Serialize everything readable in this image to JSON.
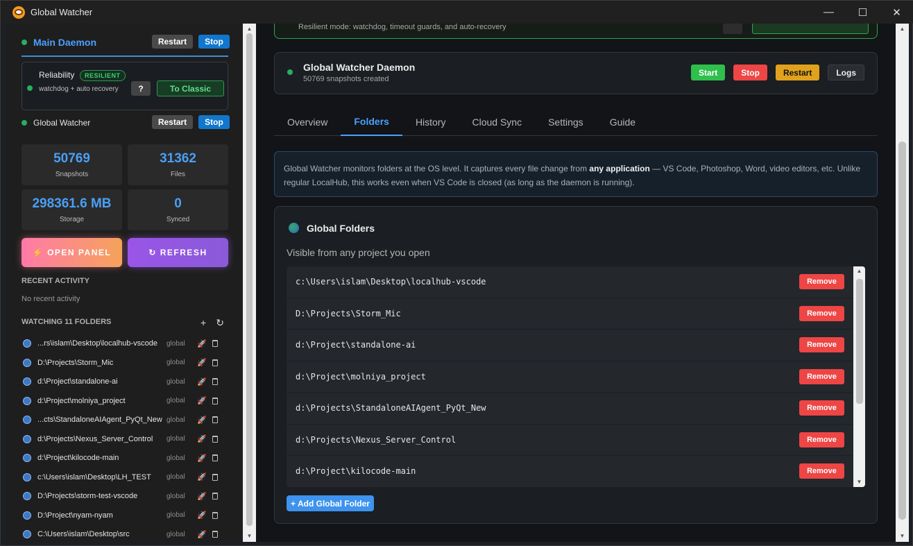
{
  "window": {
    "title": "Global Watcher"
  },
  "sidebar": {
    "main_daemon": {
      "name": "Main Daemon",
      "restart_label": "Restart",
      "stop_label": "Stop"
    },
    "reliability": {
      "title": "Reliability",
      "badge": "RESILIENT",
      "description": "watchdog + auto recovery",
      "help_label": "?",
      "classic_label": "To Classic"
    },
    "global_watcher": {
      "name": "Global Watcher",
      "restart_label": "Restart",
      "stop_label": "Stop"
    },
    "stats": [
      {
        "value": "50769",
        "label": "Snapshots"
      },
      {
        "value": "31362",
        "label": "Files"
      },
      {
        "value": "298361.6 MB",
        "label": "Storage"
      },
      {
        "value": "0",
        "label": "Synced"
      }
    ],
    "open_panel_label": "⚡ OPEN PANEL",
    "refresh_label": "↻ REFRESH",
    "recent_activity_label": "RECENT ACTIVITY",
    "no_activity": "No recent activity",
    "watching_label": "WATCHING 11 FOLDERS",
    "add_icon_glyph": "+",
    "refresh_icon_glyph": "↻",
    "folders": [
      {
        "path": "...rs\\islam\\Desktop\\localhub-vscode",
        "tag": "global"
      },
      {
        "path": "D:\\Projects\\Storm_Mic",
        "tag": "global"
      },
      {
        "path": "d:\\Project\\standalone-ai",
        "tag": "global"
      },
      {
        "path": "d:\\Project\\molniya_project",
        "tag": "global"
      },
      {
        "path": "...cts\\StandaloneAIAgent_PyQt_New",
        "tag": "global"
      },
      {
        "path": "d:\\Projects\\Nexus_Server_Control",
        "tag": "global"
      },
      {
        "path": "d:\\Project\\kilocode-main",
        "tag": "global"
      },
      {
        "path": "c:\\Users\\islam\\Desktop\\LH_TEST",
        "tag": "global"
      },
      {
        "path": "D:\\Projects\\storm-test-vscode",
        "tag": "global"
      },
      {
        "path": "D:\\Project\\nyam-nyam",
        "tag": "global"
      },
      {
        "path": "C:\\Users\\islam\\Desktop\\src",
        "tag": "global"
      }
    ]
  },
  "main": {
    "resilient_text": "Resilient mode: watchdog, timeout guards, and auto-recovery",
    "daemon": {
      "title": "Global Watcher Daemon",
      "subtitle": "50769 snapshots created",
      "start_label": "Start",
      "stop_label": "Stop",
      "restart_label": "Restart",
      "logs_label": "Logs"
    },
    "tabs": [
      "Overview",
      "Folders",
      "History",
      "Cloud Sync",
      "Settings",
      "Guide"
    ],
    "active_tab": "Folders",
    "info": {
      "part1": "Global Watcher monitors folders at the OS level. It captures every file change from ",
      "bold": "any application",
      "part2": " — VS Code, Photoshop, Word, video editors, etc. Unlike regular LocalHub, this works even when VS Code is closed (as long as the daemon is running)."
    },
    "global_folders": {
      "title": "Global Folders",
      "subtitle": "Visible from any project you open",
      "remove_label": "Remove",
      "add_label": "+ Add Global Folder",
      "paths": [
        "c:\\Users\\islam\\Desktop\\localhub-vscode",
        "D:\\Projects\\Storm_Mic",
        "d:\\Project\\standalone-ai",
        "d:\\Project\\molniya_project",
        "d:\\Projects\\StandaloneAIAgent_PyQt_New",
        "d:\\Projects\\Nexus_Server_Control",
        "d:\\Project\\kilocode-main"
      ]
    }
  },
  "colors": {
    "accent": "#4aa0ff",
    "status_green": "#27ae60",
    "danger": "#ee4545",
    "warning": "#e0a21c"
  }
}
